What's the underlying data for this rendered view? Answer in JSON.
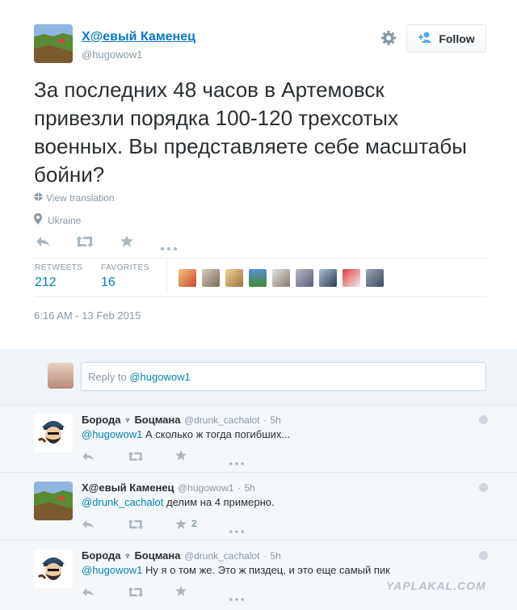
{
  "tweet": {
    "author_name": "Х@евый Каменец",
    "author_handle": "@hugowow1",
    "follow_label": "Follow",
    "text": "За последних 48 часов в Артемовск привезли порядка 100-120 трехсотых военных. Вы представляете себе масштабы бойни?",
    "view_translation": "View translation",
    "location": "Ukraine",
    "retweets_label": "RETWEETS",
    "retweets_count": "212",
    "favorites_label": "FAVORITES",
    "favorites_count": "16",
    "timestamp": "6:16 AM - 13 Feb 2015"
  },
  "reply_box": {
    "placeholder_prefix": "Reply to",
    "placeholder_handle": "@hugowow1"
  },
  "replies": [
    {
      "name": "Борода ♆ Боцмана",
      "handle": "@drunk_cachalot",
      "time": "5h",
      "mention": "@hugowow1",
      "text": "А сколько ж тогда погибших...",
      "fav_count": ""
    },
    {
      "name": "Х@евый Каменец",
      "handle": "@hugowow1",
      "time": "5h",
      "mention": "@drunk_cachalot",
      "text": "делим на 4 примерно.",
      "fav_count": "2"
    },
    {
      "name": "Борода ♆ Боцмана",
      "handle": "@drunk_cachalot",
      "time": "5h",
      "mention": "@hugowow1",
      "text": "Ну я о том же. Это ж пиздец, и это еще самый пик",
      "fav_count": ""
    }
  ],
  "watermark": "YAPLAKAL.COM",
  "colors": {
    "link": "#0084b4",
    "muted": "#8899a6",
    "reply_bg": "#eff4f9"
  },
  "icons": [
    "gear-icon",
    "add-user-icon",
    "globe-icon",
    "location-icon",
    "reply-icon",
    "retweet-icon",
    "favorite-icon",
    "more-icon",
    "close-icon"
  ]
}
